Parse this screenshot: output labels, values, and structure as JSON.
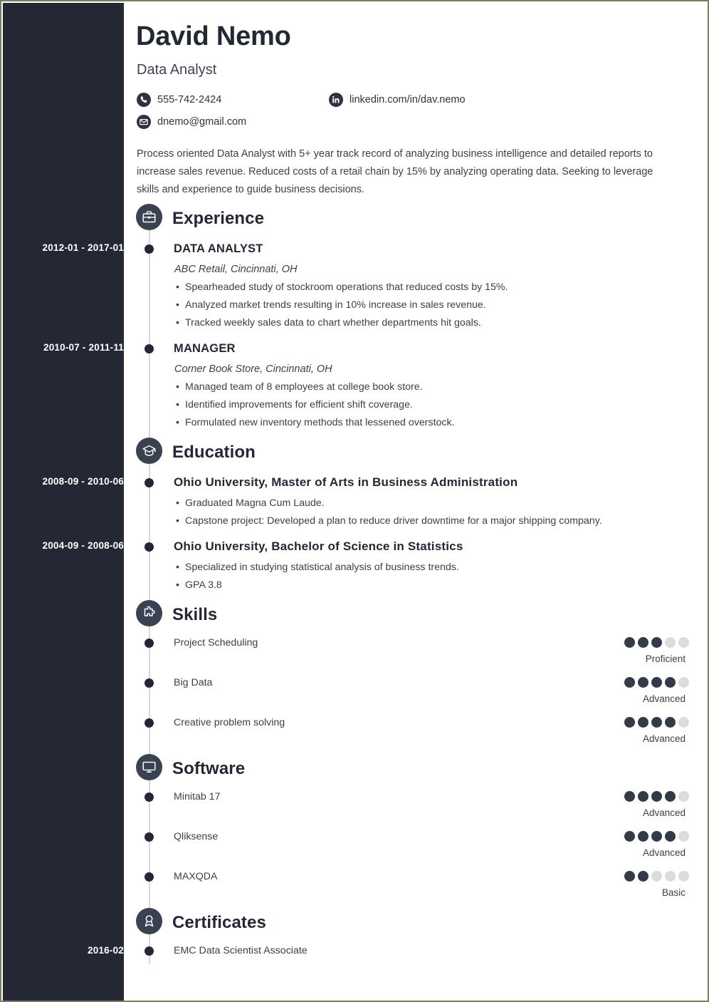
{
  "document": {
    "type": "resume",
    "border_color": "#7d7d5e",
    "sidebar_color": "#232834",
    "accent_color": "#343a47"
  },
  "header": {
    "name": "David Nemo",
    "job_title": "Data Analyst",
    "contacts": [
      {
        "icon": "phone-icon",
        "value": "555-742-2424"
      },
      {
        "icon": "linkedin-icon",
        "value": "linkedin.com/in/dav.nemo"
      },
      {
        "icon": "email-icon",
        "value": "dnemo@gmail.com"
      }
    ],
    "summary": "Process oriented Data Analyst with 5+ year track record of analyzing business intelligence and detailed reports to increase sales revenue. Reduced costs of a retail chain by 15% by analyzing operating data. Seeking to leverage skills and experience to guide business decisions."
  },
  "sections": {
    "experience": {
      "title": "Experience",
      "icon": "briefcase-icon",
      "entries": [
        {
          "date": "2012-01 - 2017-01",
          "title": "DATA ANALYST",
          "subtitle": "ABC Retail, Cincinnati, OH",
          "bullets": [
            "Spearheaded study of stockroom operations that reduced costs by 15%.",
            "Analyzed market trends resulting in 10% increase in sales revenue.",
            "Tracked weekly sales data to chart whether departments hit goals."
          ]
        },
        {
          "date": "2010-07 - 2011-11",
          "title": "MANAGER",
          "subtitle": "Corner Book Store, Cincinnati, OH",
          "bullets": [
            "Managed team of 8 employees at college book store.",
            "Identified improvements for efficient shift coverage.",
            "Formulated new inventory methods that lessened overstock."
          ]
        }
      ]
    },
    "education": {
      "title": "Education",
      "icon": "graduation-cap-icon",
      "entries": [
        {
          "date": "2008-09 - 2010-06",
          "title": "Ohio University, Master of Arts in Business Administration",
          "bullets": [
            "Graduated Magna Cum Laude.",
            "Capstone project: Developed a plan to reduce driver downtime for a major shipping company."
          ]
        },
        {
          "date": "2004-09 - 2008-06",
          "title": "Ohio University, Bachelor of Science in Statistics",
          "bullets": [
            "Specialized in studying statistical analysis of business trends.",
            "GPA 3.8"
          ]
        }
      ]
    },
    "skills": {
      "title": "Skills",
      "icon": "puzzle-piece-icon",
      "max_rating": 5,
      "items": [
        {
          "name": "Project Scheduling",
          "rating": 3,
          "level": "Proficient"
        },
        {
          "name": "Big Data",
          "rating": 4,
          "level": "Advanced"
        },
        {
          "name": "Creative problem solving",
          "rating": 4,
          "level": "Advanced"
        }
      ]
    },
    "software": {
      "title": "Software",
      "icon": "monitor-icon",
      "max_rating": 5,
      "items": [
        {
          "name": "Minitab 17",
          "rating": 4,
          "level": "Advanced"
        },
        {
          "name": "Qliksense",
          "rating": 4,
          "level": "Advanced"
        },
        {
          "name": "MAXQDA",
          "rating": 2,
          "level": "Basic"
        }
      ]
    },
    "certificates": {
      "title": "Certificates",
      "icon": "award-ribbon-icon",
      "entries": [
        {
          "date": "2016-02",
          "title": "EMC Data Scientist Associate"
        }
      ]
    }
  }
}
